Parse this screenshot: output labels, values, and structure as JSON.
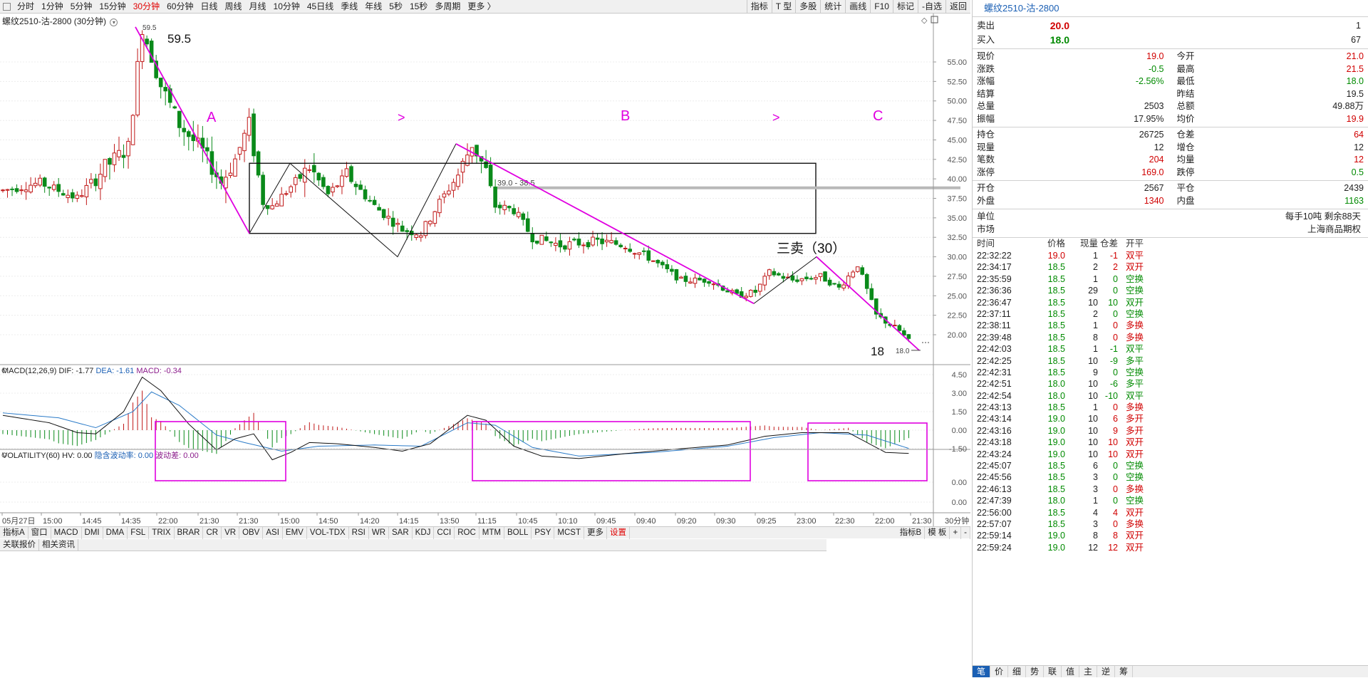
{
  "toolbar": {
    "periods": [
      "分时",
      "1分钟",
      "5分钟",
      "15分钟",
      "30分钟",
      "60分钟",
      "日线",
      "周线",
      "月线",
      "10分钟",
      "45日线",
      "季线",
      "年线",
      "5秒",
      "15秒",
      "多周期",
      "更多 〉"
    ],
    "active_period": "30分钟",
    "right_buttons": [
      "指标",
      "T 型",
      "多股",
      "统计",
      "画线",
      "F10",
      "标记",
      "-自选",
      "返回"
    ]
  },
  "chart_title": "螺纹2510-沽-2800 (30分钟)",
  "main_chart": {
    "y_ticks": [
      "55.00",
      "52.50",
      "50.00",
      "47.50",
      "45.00",
      "42.50",
      "40.00",
      "37.50",
      "35.00",
      "32.50",
      "30.00",
      "27.50",
      "25.00",
      "22.50",
      "20.00"
    ],
    "high_marker": "59.5",
    "low_marker": "18.0",
    "range_label": "39.0 - 38.5",
    "annotations": {
      "high_label": "59.5",
      "a_label": "A",
      "arrow1": ">",
      "b_label": "B",
      "arrow2": ">",
      "c_label": "C",
      "sell_label": "三卖（30）",
      "low_label": "18"
    }
  },
  "macd": {
    "label_name": "MACD(12,26,9)",
    "dif": "DIF: -1.77",
    "dea": "DEA: -1.61",
    "macd": "MACD: -0.34",
    "y_ticks": [
      "4.50",
      "3.00",
      "1.50",
      "0.00",
      "-1.50"
    ]
  },
  "volatility": {
    "label_name": "VOLATILITY(60)",
    "hv": "HV: 0.00",
    "iv": "隐含波动率: 0.00",
    "wave": "波动差: 0.00",
    "y_ticks": [
      "0.00",
      "0.00"
    ]
  },
  "x_axis": {
    "labels": [
      "05月27日",
      "15:00",
      "14:45",
      "14:35",
      "22:00",
      "21:30",
      "21:30",
      "15:00",
      "14:50",
      "14:20",
      "14:15",
      "13:50",
      "11:15",
      "10:45",
      "10:10",
      "09:45",
      "09:40",
      "09:20",
      "09:30",
      "09:25",
      "23:00",
      "22:30",
      "22:00",
      "21:30"
    ],
    "period": "30分钟"
  },
  "indicator_tabs": [
    "指标A",
    "窗口",
    "MACD",
    "DMI",
    "DMA",
    "FSL",
    "TRIX",
    "BRAR",
    "CR",
    "VR",
    "OBV",
    "ASI",
    "EMV",
    "VOL-TDX",
    "RSI",
    "WR",
    "SAR",
    "KDJ",
    "CCI",
    "ROC",
    "MTM",
    "BOLL",
    "PSY",
    "MCST",
    "更多",
    "设置"
  ],
  "indicator_right": [
    "指标B",
    "模 板",
    "+",
    "-"
  ],
  "sub_tabs": [
    "关联报价",
    "相关资讯"
  ],
  "quote": {
    "title": "螺纹2510-沽-2800",
    "sell": {
      "label": "卖出",
      "price": "20.0",
      "vol": "1"
    },
    "buy": {
      "label": "买入",
      "price": "18.0",
      "vol": "67"
    },
    "stats": [
      [
        {
          "k": "现价",
          "v": "19.0",
          "c": "red"
        },
        {
          "k": "今开",
          "v": "21.0",
          "c": "red"
        }
      ],
      [
        {
          "k": "涨跌",
          "v": "-0.5",
          "c": "green"
        },
        {
          "k": "最高",
          "v": "21.5",
          "c": "red"
        }
      ],
      [
        {
          "k": "涨幅",
          "v": "-2.56%",
          "c": "green"
        },
        {
          "k": "最低",
          "v": "18.0",
          "c": "green"
        }
      ],
      [
        {
          "k": "结算",
          "v": "",
          "c": ""
        },
        {
          "k": "昨结",
          "v": "19.5",
          "c": ""
        }
      ],
      [
        {
          "k": "总量",
          "v": "2503",
          "c": ""
        },
        {
          "k": "总额",
          "v": "49.88万",
          "c": ""
        }
      ],
      [
        {
          "k": "振幅",
          "v": "17.95%",
          "c": ""
        },
        {
          "k": "均价",
          "v": "19.9",
          "c": "red"
        }
      ]
    ],
    "stats2": [
      [
        {
          "k": "持仓",
          "v": "26725",
          "c": ""
        },
        {
          "k": "仓差",
          "v": "64",
          "c": "red"
        }
      ],
      [
        {
          "k": "现量",
          "v": "12",
          "c": ""
        },
        {
          "k": "增仓",
          "v": "12",
          "c": ""
        }
      ],
      [
        {
          "k": "笔数",
          "v": "204",
          "c": "red"
        },
        {
          "k": "均量",
          "v": "12",
          "c": "red"
        }
      ],
      [
        {
          "k": "涨停",
          "v": "169.0",
          "c": "red"
        },
        {
          "k": "跌停",
          "v": "0.5",
          "c": "green"
        }
      ]
    ],
    "stats3": [
      [
        {
          "k": "开仓",
          "v": "2567",
          "c": ""
        },
        {
          "k": "平仓",
          "v": "2439",
          "c": ""
        }
      ],
      [
        {
          "k": "外盘",
          "v": "1340",
          "c": "red"
        },
        {
          "k": "内盘",
          "v": "1163",
          "c": "green"
        }
      ]
    ],
    "unit": {
      "k": "单位",
      "v": "每手10吨  剩余88天"
    },
    "market": {
      "k": "市场",
      "v": "上海商品期权"
    },
    "tick_header": [
      "时间",
      "价格",
      "现量",
      "仓差",
      "开平"
    ],
    "ticks": [
      [
        "22:32:22",
        "19.0",
        "1",
        "-1",
        "双平",
        "red",
        "red",
        "red"
      ],
      [
        "22:34:17",
        "18.5",
        "2",
        "2",
        "双开",
        "green",
        "red",
        "red"
      ],
      [
        "22:35:59",
        "18.5",
        "1",
        "0",
        "空换",
        "green",
        "green",
        "green"
      ],
      [
        "22:36:36",
        "18.5",
        "29",
        "0",
        "空换",
        "green",
        "green",
        "green"
      ],
      [
        "22:36:47",
        "18.5",
        "10",
        "10",
        "双开",
        "green",
        "green",
        "green"
      ],
      [
        "22:37:11",
        "18.5",
        "2",
        "0",
        "空换",
        "green",
        "green",
        "green"
      ],
      [
        "22:38:11",
        "18.5",
        "1",
        "0",
        "多换",
        "green",
        "red",
        "red"
      ],
      [
        "22:39:48",
        "18.5",
        "8",
        "0",
        "多换",
        "green",
        "red",
        "red"
      ],
      [
        "22:42:03",
        "18.5",
        "1",
        "-1",
        "双平",
        "green",
        "green",
        "green"
      ],
      [
        "22:42:25",
        "18.5",
        "10",
        "-9",
        "多平",
        "green",
        "green",
        "green"
      ],
      [
        "22:42:31",
        "18.5",
        "9",
        "0",
        "空换",
        "green",
        "green",
        "green"
      ],
      [
        "22:42:51",
        "18.0",
        "10",
        "-6",
        "多平",
        "green",
        "green",
        "green"
      ],
      [
        "22:42:54",
        "18.0",
        "10",
        "-10",
        "双平",
        "green",
        "green",
        "green"
      ],
      [
        "22:43:13",
        "18.5",
        "1",
        "0",
        "多换",
        "green",
        "red",
        "red"
      ],
      [
        "22:43:14",
        "19.0",
        "10",
        "6",
        "多开",
        "green",
        "red",
        "red"
      ],
      [
        "22:43:16",
        "19.0",
        "10",
        "9",
        "多开",
        "green",
        "red",
        "red"
      ],
      [
        "22:43:18",
        "19.0",
        "10",
        "10",
        "双开",
        "green",
        "red",
        "red"
      ],
      [
        "22:43:24",
        "19.0",
        "10",
        "10",
        "双开",
        "green",
        "red",
        "red"
      ],
      [
        "22:45:07",
        "18.5",
        "6",
        "0",
        "空换",
        "green",
        "green",
        "green"
      ],
      [
        "22:45:56",
        "18.5",
        "3",
        "0",
        "空换",
        "green",
        "green",
        "green"
      ],
      [
        "22:46:13",
        "18.5",
        "3",
        "0",
        "多换",
        "green",
        "red",
        "red"
      ],
      [
        "22:47:39",
        "18.0",
        "1",
        "0",
        "空换",
        "green",
        "green",
        "green"
      ],
      [
        "22:56:00",
        "18.5",
        "4",
        "4",
        "双开",
        "green",
        "red",
        "red"
      ],
      [
        "22:57:07",
        "18.5",
        "3",
        "0",
        "多换",
        "green",
        "red",
        "red"
      ],
      [
        "22:59:14",
        "19.0",
        "8",
        "8",
        "双开",
        "green",
        "red",
        "red"
      ],
      [
        "22:59:24",
        "19.0",
        "12",
        "12",
        "双开",
        "green",
        "red",
        "red"
      ]
    ],
    "bottom_tabs": [
      "笔",
      "价",
      "细",
      "势",
      "联",
      "值",
      "主",
      "逆",
      "筹"
    ]
  },
  "colors": {
    "up": "#c01818",
    "down": "#0a8a1a",
    "accent": "#e000e0",
    "blue": "#1a5fb4"
  }
}
